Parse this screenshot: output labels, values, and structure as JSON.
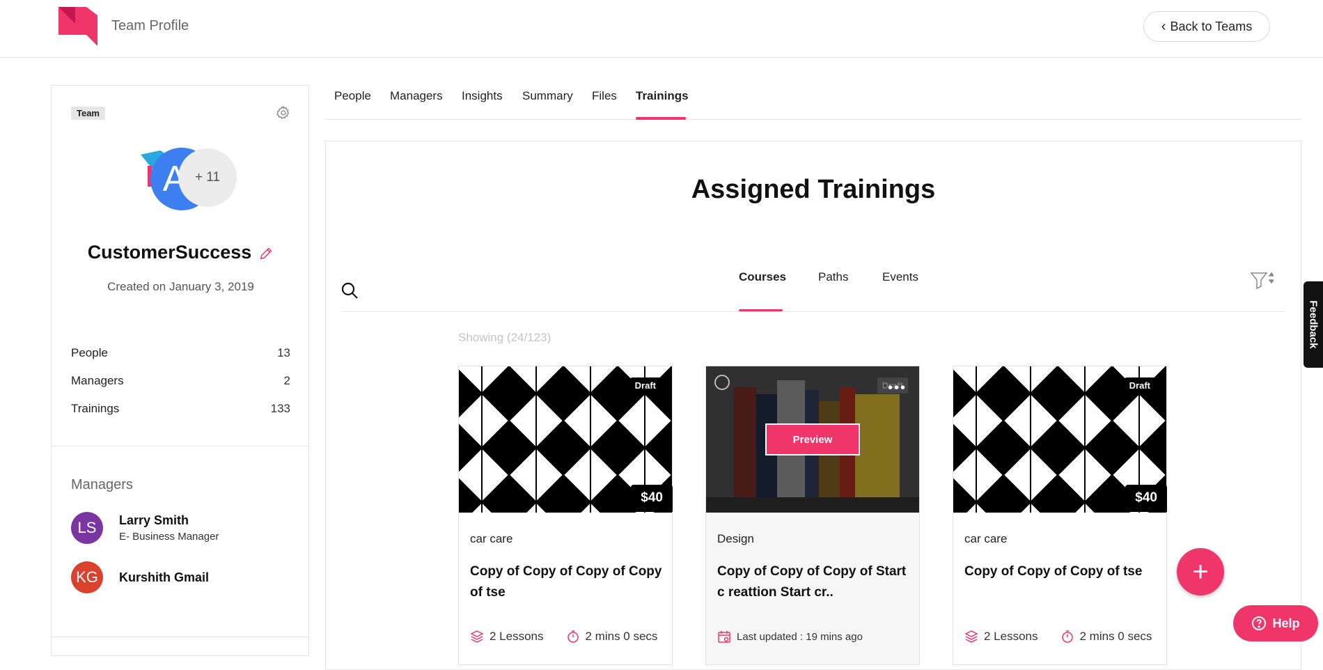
{
  "header": {
    "title": "Team Profile",
    "back_label": "Back to Teams"
  },
  "sidebar": {
    "badge": "Team",
    "avatar_letter": "A",
    "avatar_more": "+ 11",
    "team_name": "CustomerSuccess",
    "created": "Created on January 3, 2019",
    "stats": [
      {
        "label": "People",
        "value": "13"
      },
      {
        "label": "Managers",
        "value": "2"
      },
      {
        "label": "Trainings",
        "value": "133"
      }
    ],
    "managers_heading": "Managers",
    "managers": [
      {
        "initials": "LS",
        "name": "Larry Smith",
        "role": "E- Business Manager",
        "color": "#7a35a3"
      },
      {
        "initials": "KG",
        "name": "Kurshith Gmail",
        "role": "",
        "color": "#d9422e"
      }
    ]
  },
  "tabs": [
    "People",
    "Managers",
    "Insights",
    "Summary",
    "Files",
    "Trainings"
  ],
  "active_tab": "Trainings",
  "main": {
    "title": "Assigned Trainings",
    "subtabs": [
      "Courses",
      "Paths",
      "Events"
    ],
    "active_subtab": "Courses",
    "showing": "Showing (24/123)"
  },
  "cards": [
    {
      "status": "Draft",
      "price": "$40",
      "category": "car care",
      "title": "Copy of Copy of Copy of Copy of tse",
      "lessons": "2 Lessons",
      "duration": "2 mins 0 secs"
    },
    {
      "status": "Draft",
      "preview": "Preview",
      "category": "Design",
      "title": "Copy of Copy of Copy of Start c reattion Start cr..",
      "updated": "Last updated : 19 mins ago"
    },
    {
      "status": "Draft",
      "price": "$40",
      "category": "car care",
      "title": "Copy of Copy of Copy of tse",
      "lessons": "2 Lessons",
      "duration": "2 mins 0 secs"
    }
  ],
  "help_label": "Help",
  "feedback_label": "Feedback",
  "fab_label": "+",
  "colors": {
    "accent": "#f0356a",
    "avatar_blue": "#3d7ff0"
  }
}
